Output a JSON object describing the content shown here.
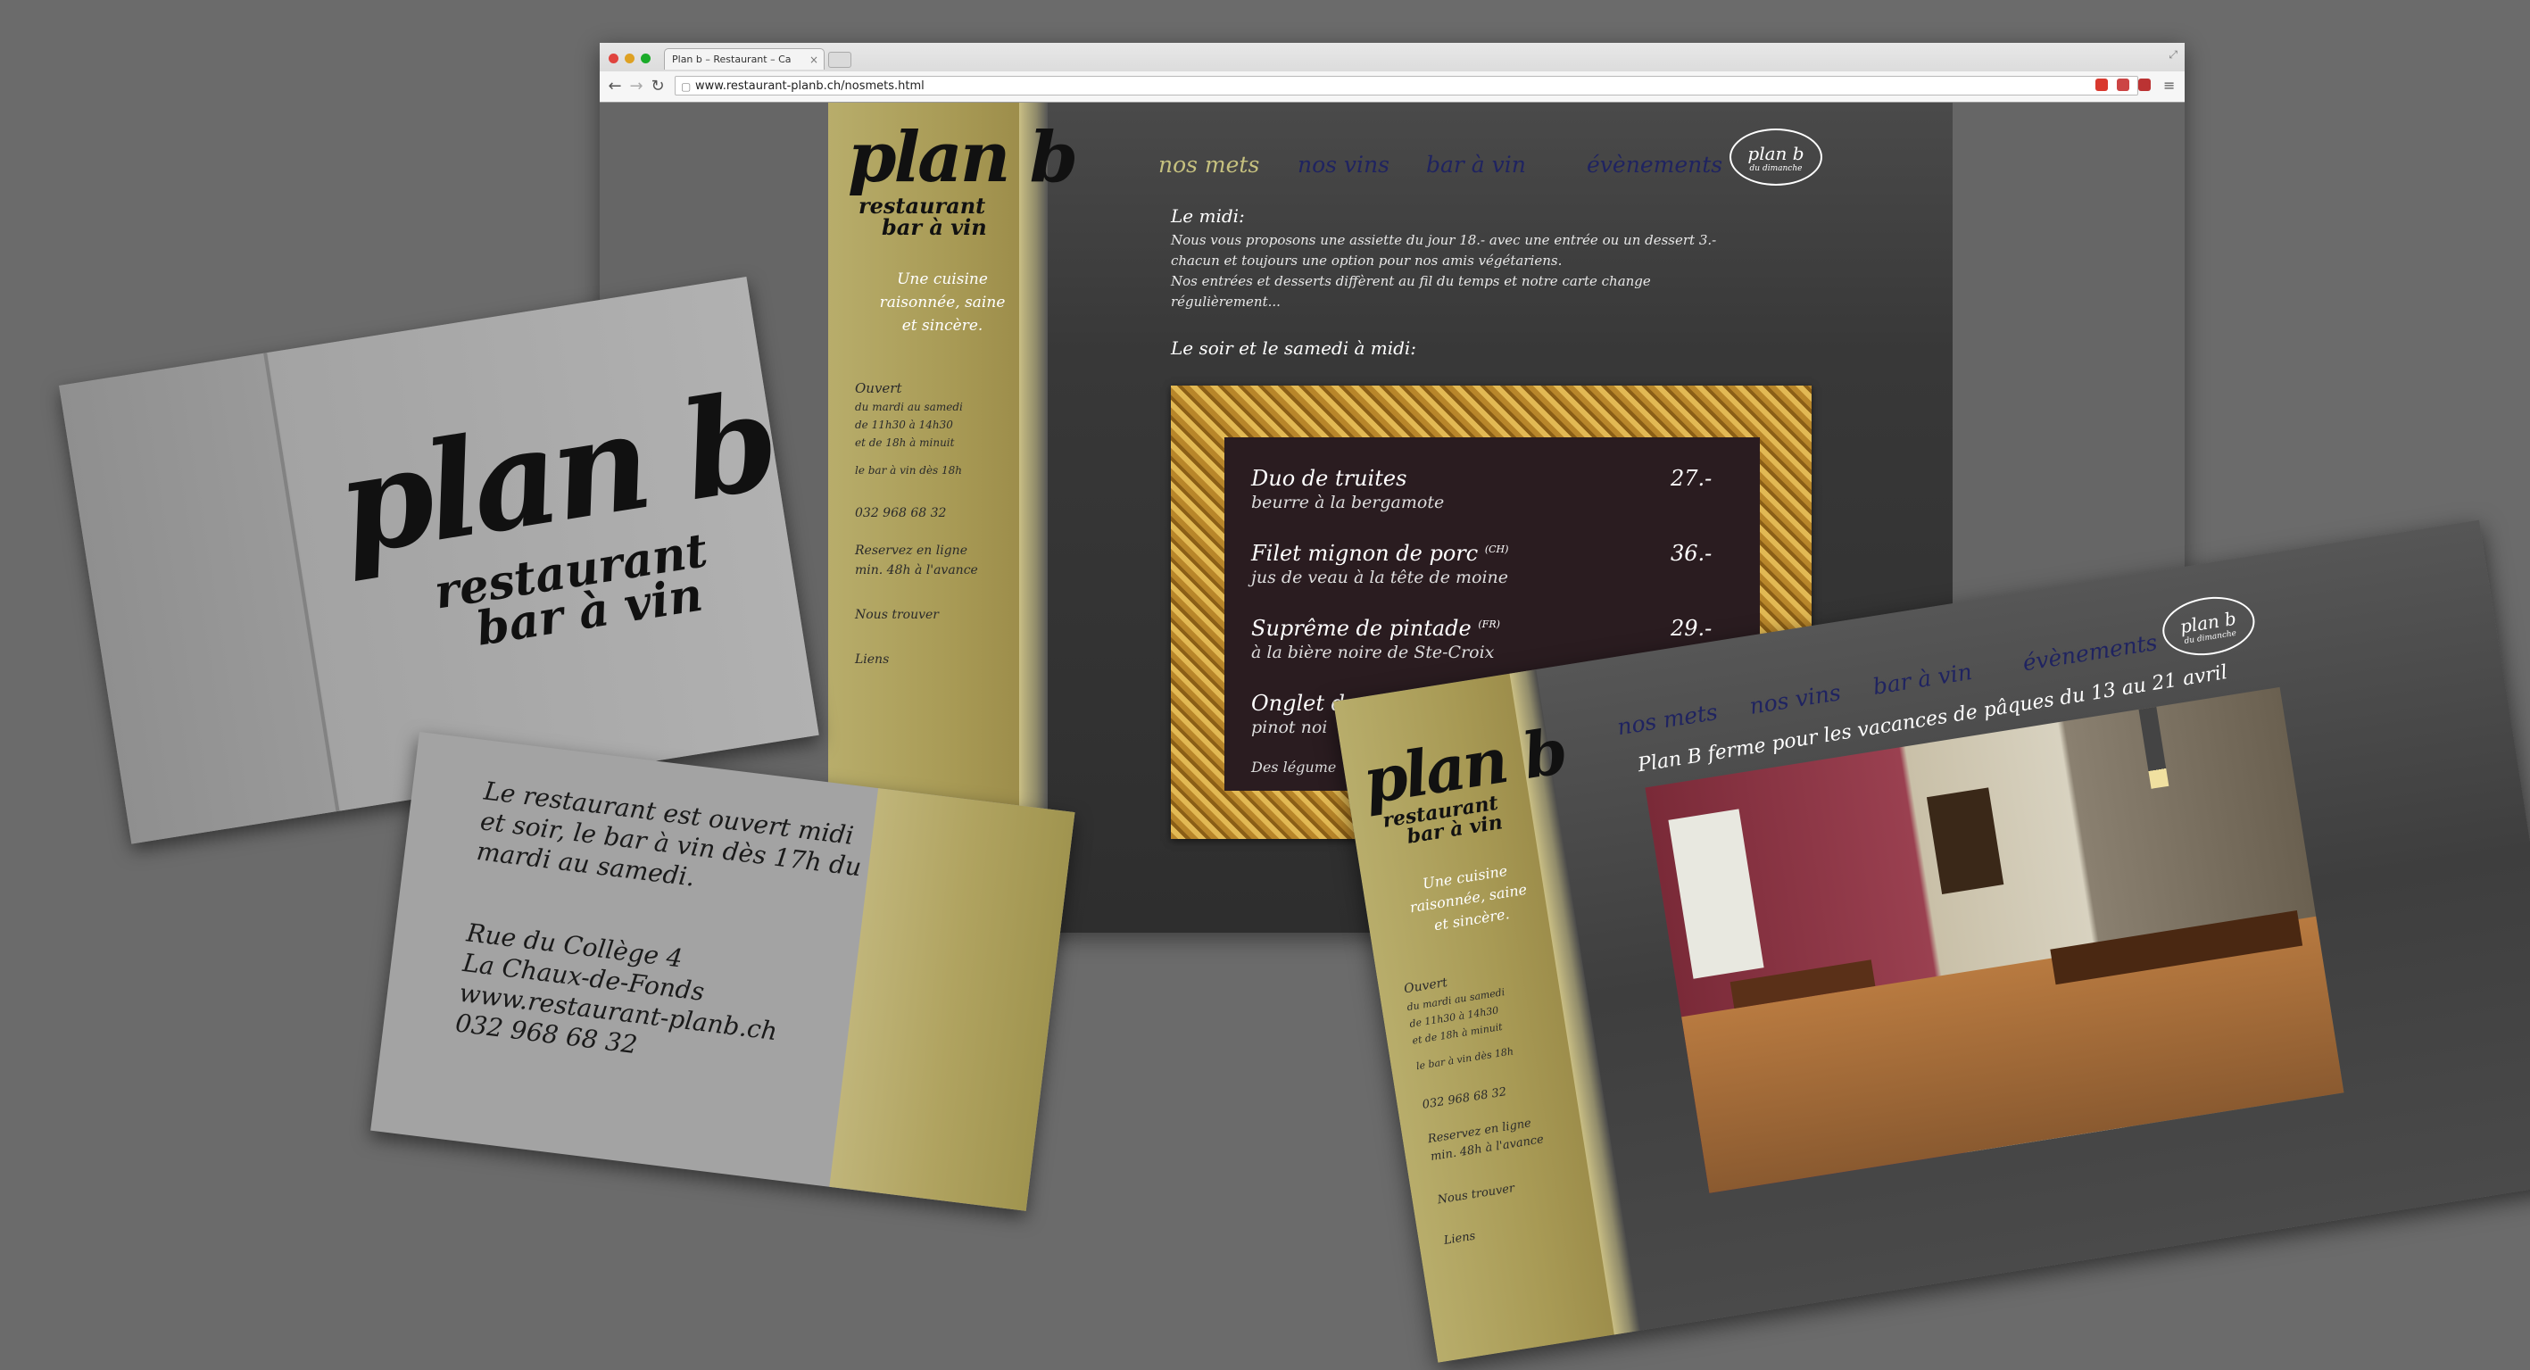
{
  "browser": {
    "tab_title": "Plan b – Restaurant – Ca",
    "tab_close": "×",
    "url": "www.restaurant-planb.ch/nosmets.html",
    "back": "←",
    "forward": "→",
    "reload": "↻",
    "star": "☆",
    "menu": "≡",
    "resize": "⤢"
  },
  "logo": {
    "plan": "plan b",
    "sub1": "restaurant",
    "sub2": "bar à vin"
  },
  "sidebar": {
    "tagline": [
      "Une cuisine",
      "raisonnée, saine",
      "et sincère."
    ],
    "hours_title": "Ouvert",
    "hours": [
      "du mardi au samedi",
      "de 11h30 à 14h30",
      "et de 18h à minuit"
    ],
    "bar": "le bar à vin dès 18h",
    "phone": "032 968 68 32",
    "reserve": [
      "Reservez en ligne",
      "min. 48h à l'avance"
    ],
    "find_us": "Nous trouver",
    "links": "Liens"
  },
  "nav": {
    "items": [
      "nos mets",
      "nos vins",
      "bar à vin",
      "évènements"
    ],
    "active": "nos mets"
  },
  "circle_logo": {
    "main": "plan b",
    "sub": "du dimanche"
  },
  "content": {
    "midi_title": "Le midi:",
    "midi_text": [
      "Nous vous proposons une assiette du jour 18.- avec une entrée ou un dessert 3.-",
      "chacun et toujours une option pour nos amis végétariens.",
      "Nos entrées et desserts diffèrent au fil du temps et notre carte change",
      "régulièrement..."
    ],
    "soir_title": "Le soir et le samedi à midi:"
  },
  "menu_board": [
    {
      "name": "Duo de truites",
      "note": "",
      "desc": "beurre à la bergamote",
      "price": "27.-"
    },
    {
      "name": "Filet mignon de porc",
      "note": "(CH)",
      "desc": "jus de veau à la tête de moine",
      "price": "36.-"
    },
    {
      "name": "Suprême de pintade",
      "note": "(FR)",
      "desc": "à la bière noire de Ste-Croix",
      "price": "29.-"
    },
    {
      "name": "Onglet d",
      "note": "",
      "desc": "pinot noi",
      "price": ""
    }
  ],
  "menu_footer": "Des légume",
  "card_front": {
    "plan": "plan b",
    "sub1": "restaurant",
    "sub2": "bar à vin"
  },
  "card_back": {
    "lines": [
      "Le restaurant est ouvert midi",
      "et soir, le bar à vin dès 17h du",
      "mardi au samedi."
    ],
    "address": [
      "Rue du Collège 4",
      "La Chaux-de-Fonds",
      "www.restaurant-planb.ch",
      "032 968 68 32"
    ]
  },
  "screen2": {
    "announcement": "Plan B ferme pour les vacances de pâques du 13 au 21 avril"
  },
  "colors": {
    "kraft": "#b0a35e",
    "nav_link": "#1f2360",
    "nav_active": "#c6c17f",
    "board": "#2a1c20",
    "frame_gold": "#c9962f"
  }
}
